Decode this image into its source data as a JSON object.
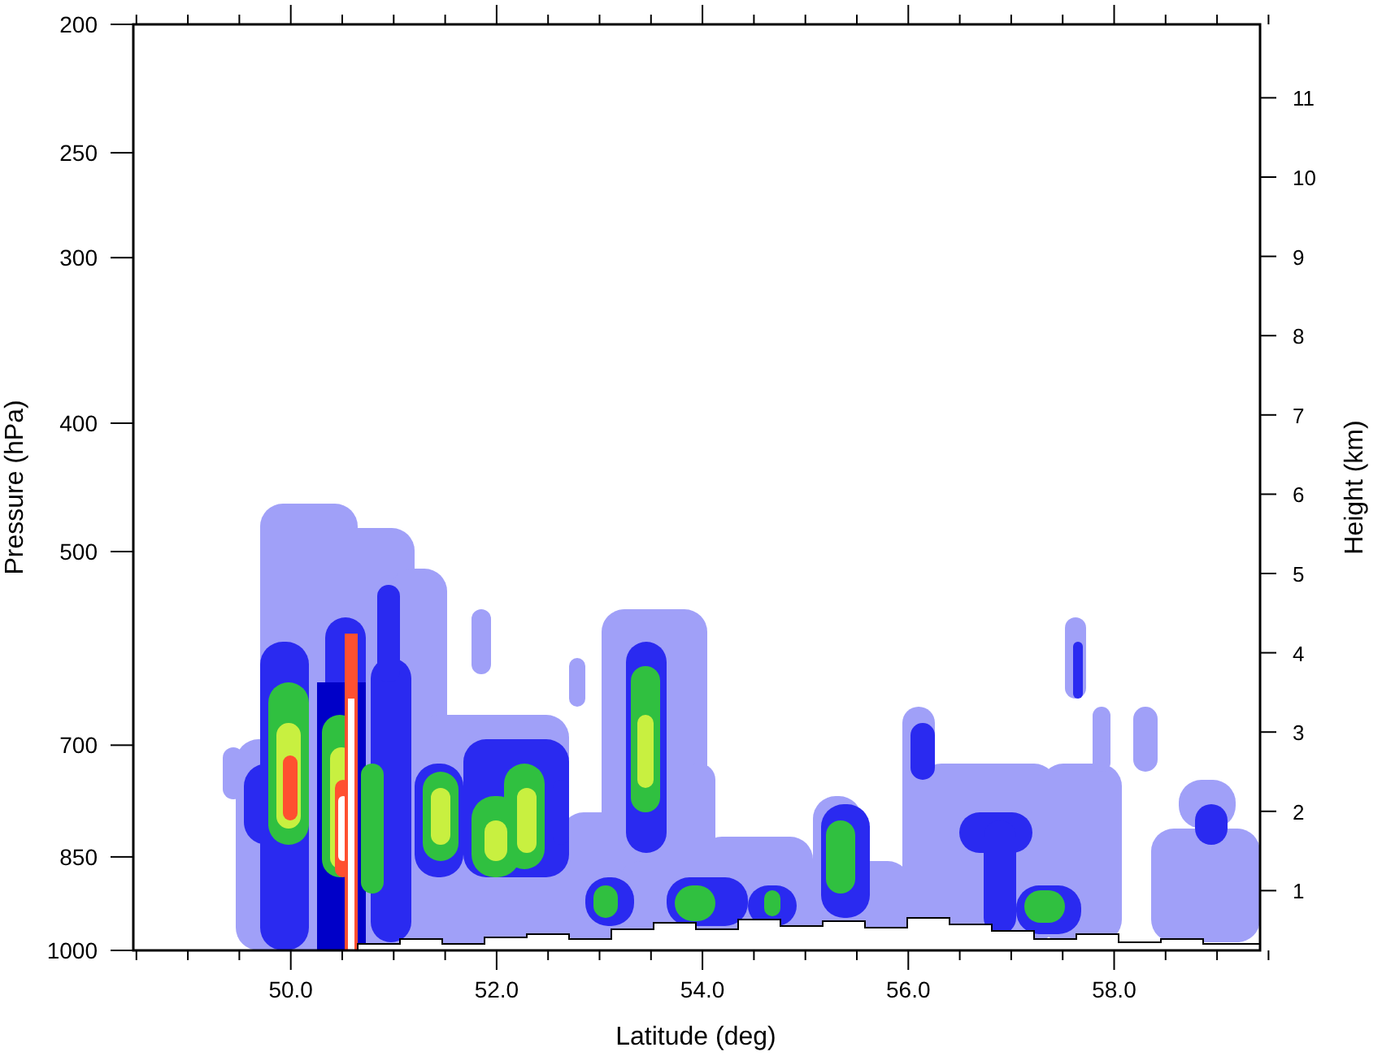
{
  "plot": {
    "xlabel": "Latitude (deg)",
    "ylabel": "Pressure (hPa)",
    "y2label": "Height (km)",
    "xticks": [
      "50.0",
      "52.0",
      "54.0",
      "56.0",
      "58.0"
    ],
    "yticks": [
      "200",
      "250",
      "300",
      "400",
      "500",
      "700",
      "850",
      "1000"
    ],
    "y2ticks": [
      "11",
      "10",
      "9",
      "8",
      "7",
      "6",
      "5",
      "4",
      "3",
      "2",
      "1"
    ]
  }
}
